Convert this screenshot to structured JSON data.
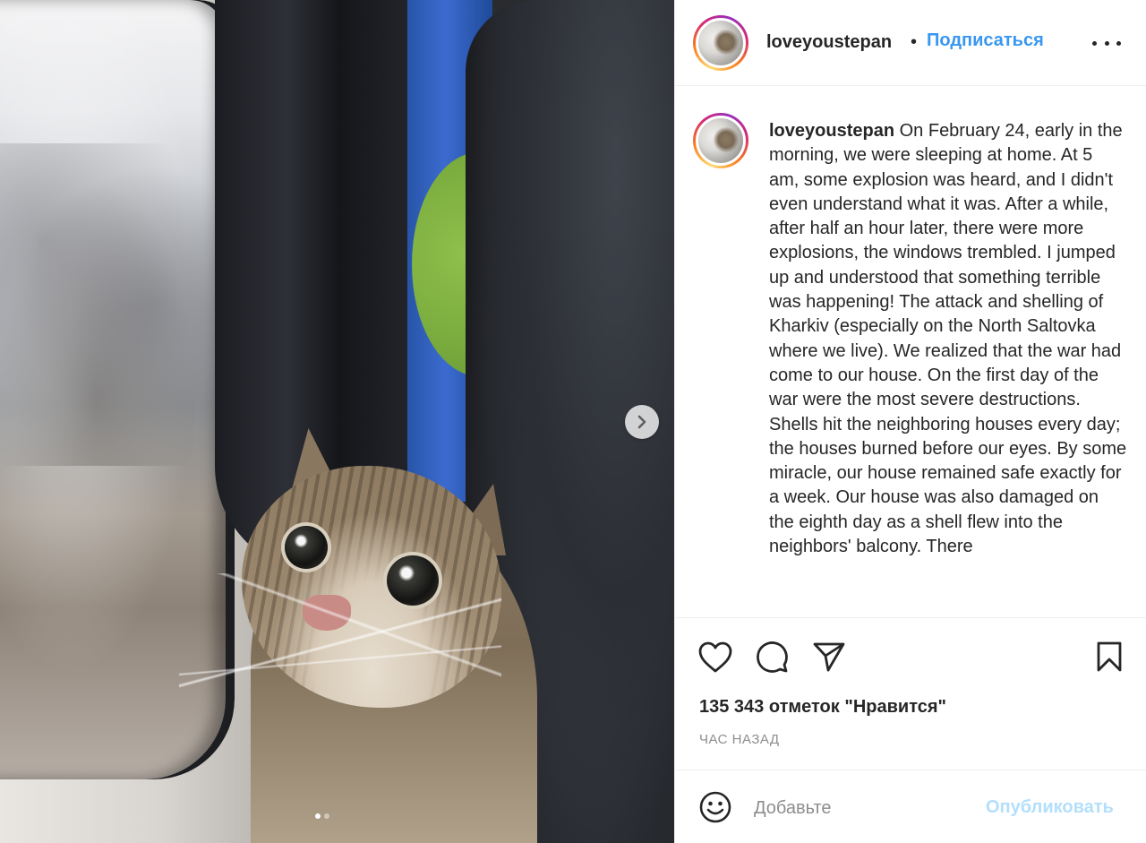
{
  "post": {
    "image_alt": "",
    "carousel": {
      "count": 2,
      "active_index": 0
    }
  },
  "header": {
    "username": "loveyoustepan",
    "separator": "•",
    "follow_label": "Подписаться",
    "more_icon": "more-horizontal-icon"
  },
  "caption": {
    "username": "loveyoustepan",
    "text": "On February 24, early in the morning, we were sleeping at home. At 5 am, some explosion was heard, and I didn't even understand what it was. After a while, after half an hour later, there were more explosions, the windows trembled. I jumped up and understood that something terrible was happening! The attack and shelling of Kharkiv (especially on the North Saltovka where we live). We realized that the war had come to our house. On the first day of the war were the most severe destructions. Shells hit the neighboring houses every day; the houses burned before our eyes. By some miracle, our house remained safe exactly for a week. Our house was also damaged on the eighth day as a shell flew into the neighbors' balcony. There"
  },
  "actions": {
    "like_icon": "heart-icon",
    "comment_icon": "comment-icon",
    "share_icon": "paper-plane-icon",
    "save_icon": "bookmark-icon",
    "likes_text": "135 343 отметок \"Нравится\"",
    "time_ago": "ЧАС НАЗАД"
  },
  "comment": {
    "emoji_icon": "smiley-icon",
    "placeholder": "Добавьте",
    "publish_label": "Опубликовать"
  },
  "colors": {
    "link_blue": "#3897f0",
    "publish_disabled": "#b2dffc",
    "text": "#262626",
    "muted": "#8e8e8e",
    "divider": "#efefef"
  }
}
